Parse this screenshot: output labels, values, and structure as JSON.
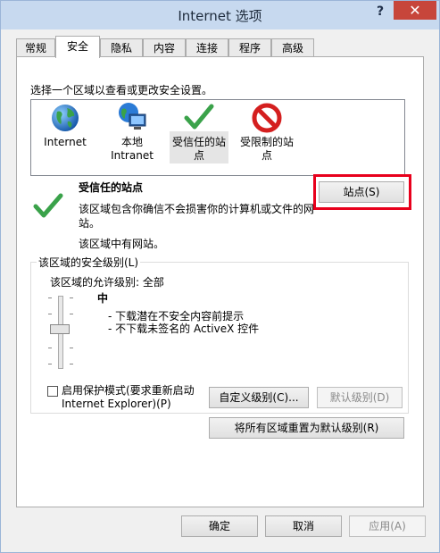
{
  "window": {
    "title": "Internet 选项",
    "help_label": "?",
    "close_label": "✕"
  },
  "tabs": [
    "常规",
    "安全",
    "隐私",
    "内容",
    "连接",
    "程序",
    "高级"
  ],
  "zone_prompt": "选择一个区域以查看或更改安全设置。",
  "zones": [
    {
      "label_line1": "Internet",
      "label_line2": "",
      "icon": "globe-icon"
    },
    {
      "label_line1": "本地",
      "label_line2": "Intranet",
      "icon": "intranet-icon"
    },
    {
      "label_line1": "受信任的站",
      "label_line2": "点",
      "icon": "checkmark-icon"
    },
    {
      "label_line1": "受限制的站",
      "label_line2": "点",
      "icon": "restricted-icon"
    }
  ],
  "zone_detail": {
    "title": "受信任的站点",
    "desc_line1": "该区域包含你确信不会损害你的计算机或文件的网",
    "desc_line2": "站。",
    "status": "该区域中有网站。",
    "sites_button": "站点(S)"
  },
  "security_level": {
    "group_title": "该区域的安全级别(L)",
    "allowed_label": "该区域的允许级别: 全部",
    "level_name": "中",
    "bullets": [
      "- 下载潜在不安全内容前提示",
      "- 不下载未签名的 ActiveX 控件"
    ],
    "protected_mode_line1": "启用保护模式(要求重新启动",
    "protected_mode_line2": "Internet Explorer)(P)",
    "custom_button": "自定义级别(C)...",
    "default_button": "默认级别(D)",
    "reset_all_button": "将所有区域重置为默认级别(R)"
  },
  "footer": {
    "ok": "确定",
    "cancel": "取消",
    "apply": "应用(A)"
  },
  "colors": {
    "highlight": "#e8001c",
    "title_bar": "#c7d9ef",
    "close": "#c7463b",
    "check_green": "#3aa24a"
  }
}
